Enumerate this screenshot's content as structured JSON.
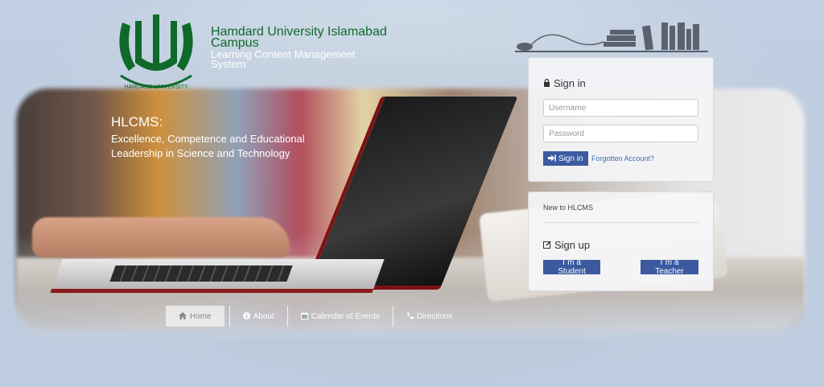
{
  "brand": {
    "university": "Hamdard University Islamabad Campus",
    "system": "Learning Content Management System",
    "logo_text": "HAMDARD UNIVERSITY"
  },
  "tagline": {
    "title": "HLCMS:",
    "text": "Excellence, Competence and Educational Leadership in Science and Technology"
  },
  "signin": {
    "title": "Sign in",
    "username_placeholder": "Username",
    "password_placeholder": "Password",
    "button_label": "Sign in",
    "forgot_label": "Forgotten Account?"
  },
  "signup": {
    "new_to": "New to HLCMS",
    "title": "Sign up",
    "student_label": "I`m a Student",
    "teacher_label": "I`m a Teacher"
  },
  "nav": {
    "items": [
      {
        "label": "Home",
        "icon": "home-icon"
      },
      {
        "label": "About",
        "icon": "info-icon"
      },
      {
        "label": "Calendar of Events",
        "icon": "calendar-icon"
      },
      {
        "label": "Directions",
        "icon": "phone-icon"
      }
    ]
  },
  "colors": {
    "brand_green": "#0f6a2a",
    "primary_button": "#3b5aa0",
    "link": "#3b6bb5"
  }
}
